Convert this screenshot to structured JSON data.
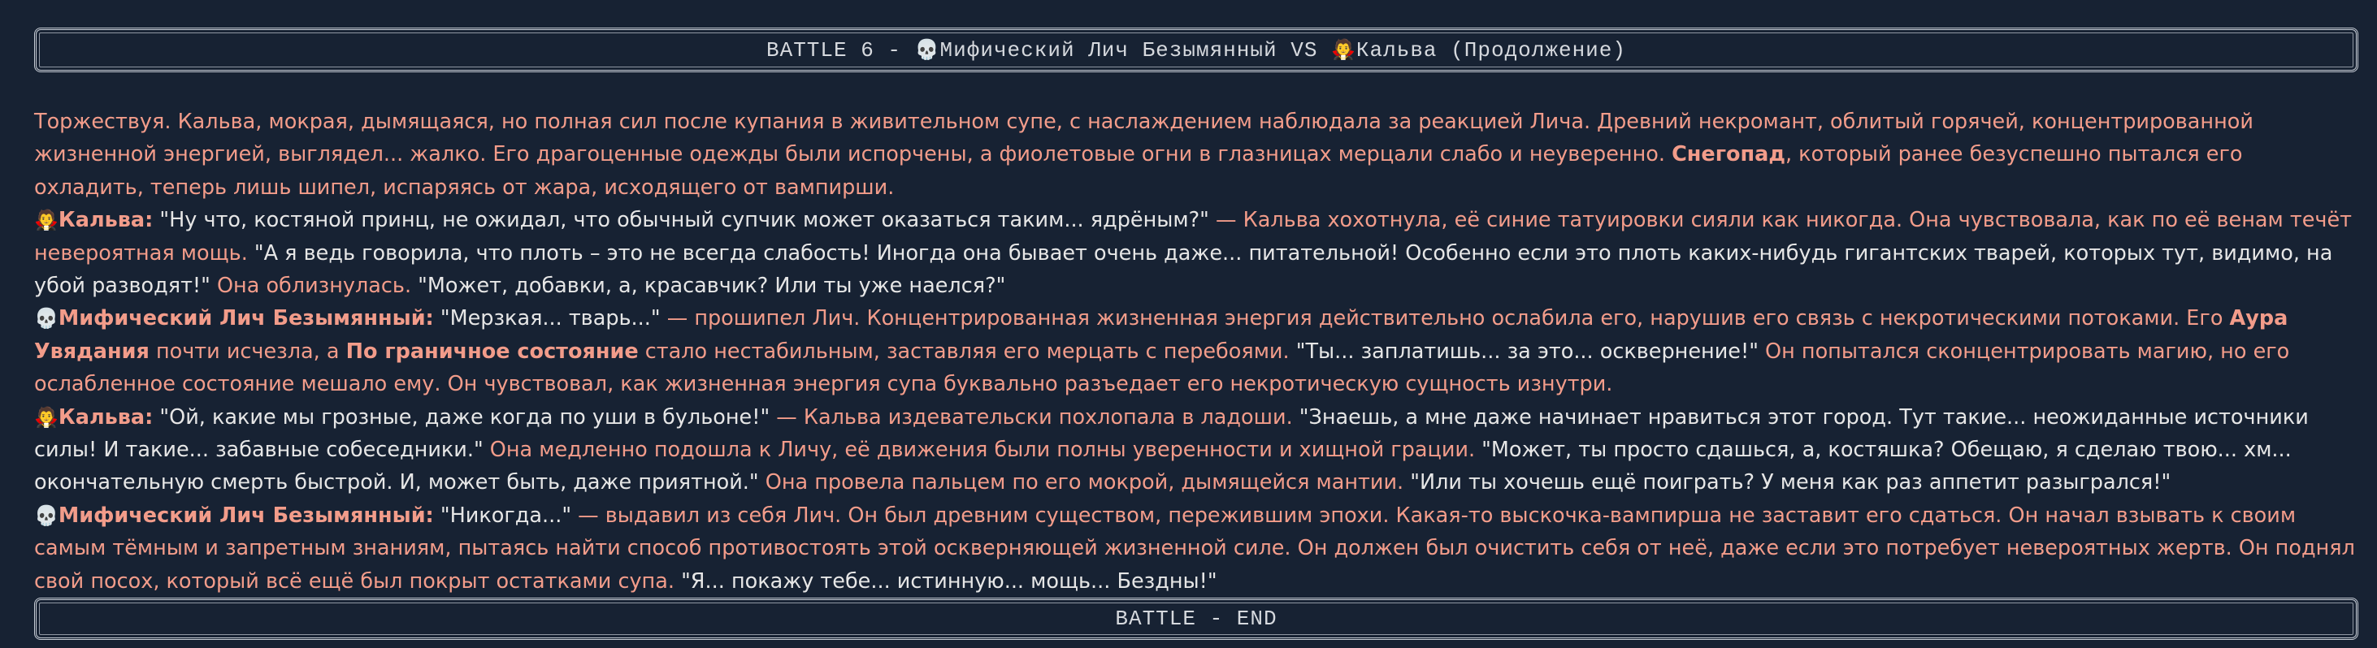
{
  "header": {
    "prefix": "BATTLE 6 - ",
    "skull_icon": "💀",
    "fighter1": "Мифический Лич Безымянный",
    "vs": " VS ",
    "vampire_icon": "🧛",
    "fighter2": "Кальва",
    "suffix": " (Продолжение)"
  },
  "story": {
    "intro": {
      "t1": "Торжествуя. Кальва, мокрая, дымящаяся, но полная сил после купания в живительном супе, с наслаждением наблюдала за реакцией Лича. Древний некромант, облитый горячей, концентрированной жизненной энергией, выглядел... жалко. Его драгоценные одежды были испорчены, а фиолетовые огни в глазницах мерцали слабо и неуверенно. ",
      "b1": "Снегопад",
      "t2": ", который ранее безуспешно пытался его охладить, теперь лишь шипел, испаряясь от жара, исходящего от вампирши."
    },
    "kalva1": {
      "icon": "🧛",
      "speaker": "Кальва:",
      "q1": " \"Ну что, костяной принц, не ожидал, что обычный супчик может оказаться таким... ядрёным?\"",
      "n1": " — Кальва хохотнула, её синие татуировки сияли как никогда. Она чувствовала, как по её венам течёт невероятная мощь.",
      "q2": " \"А я ведь говорила, что плоть – это не всегда слабость! Иногда она бывает очень даже... питательной! Особенно если это плоть каких-нибудь гигантских тварей, которых тут, видимо, на убой разводят!\"",
      "n2": " Она облизнулась.",
      "q3": " \"Может, добавки, а, красавчик? Или ты уже наелся?\""
    },
    "lich1": {
      "icon": "💀",
      "speaker": "Мифический Лич Безымянный:",
      "q1": " \"Мерзкая... тварь...\"",
      "n1": " — прошипел Лич. Концентрированная жизненная энергия действительно ослабила его, нарушив его связь с некротическими потоками. Его ",
      "b1": "Аура Увядания",
      "n2": " почти исчезла, а ",
      "b2": "По граничное состояние",
      "n3": " стало нестабильным, заставляя его мерцать с перебоями.",
      "q2": " \"Ты... заплатишь... за это... осквернение!\"",
      "n4": " Он попытался сконцентрировать магию, но его ослабленное состояние мешало ему. Он чувствовал, как жизненная энергия супа буквально разъедает его некротическую сущность изнутри."
    },
    "kalva2": {
      "icon": "🧛",
      "speaker": "Кальва:",
      "q1": " \"Ой, какие мы грозные, даже когда по уши в бульоне!\"",
      "n1": " — Кальва издевательски похлопала в ладоши.",
      "q2": " \"Знаешь, а мне даже начинает нравиться этот город. Тут такие... неожиданные источники силы! И такие... забавные собеседники.\"",
      "n2": " Она медленно подошла к Личу, её движения были полны уверенности и хищной грации.",
      "q3": " \"Может, ты просто сдашься, а, костяшка? Обещаю, я сделаю твою... хм... окончательную смерть быстрой. И, может быть, даже приятной.\"",
      "n3": " Она провела пальцем по его мокрой, дымящейся мантии.",
      "q4": " \"Или ты хочешь ещё поиграть? У меня как раз аппетит разыгрался!\""
    },
    "lich2": {
      "icon": "💀",
      "speaker": "Мифический Лич Безымянный:",
      "q1": " \"Никогда...\"",
      "n1": " — выдавил из себя Лич. Он был древним существом, пережившим эпохи. Какая-то выскочка-вампирша не заставит его сдаться. Он начал взывать к своим самым тёмным и запретным знаниям, пытаясь найти способ противостоять этой оскверняющей жизненной силе. Он должен был очистить себя от неё, даже если это потребует невероятных жертв. Он поднял свой посох, который всё ещё был покрыт остатками супа.",
      "q2": " \"Я... покажу тебе... истинную... мощь... Бездны!\""
    }
  },
  "footer": {
    "label": "BATTLE - END"
  },
  "colors": {
    "background": "#172233",
    "narration": "#f29c8a",
    "speech": "#e6e6e6",
    "banner_border": "#c7cdd6"
  },
  "icons": {
    "skull": "skull-icon",
    "vampire": "vampire-icon"
  }
}
